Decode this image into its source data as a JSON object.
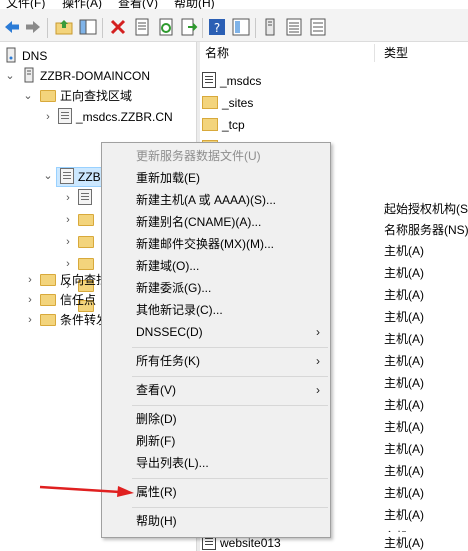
{
  "menubar": {
    "items": [
      "文件(F)",
      "操作(A)",
      "查看(V)",
      "帮助(H)"
    ]
  },
  "tree": {
    "root": "DNS",
    "server": "ZZBR-DOMAINCON",
    "forward_zones": "正向查找区域",
    "msdcs_zone": "_msdcs.ZZBR.CN",
    "zzbr_zone": "ZZBR.CN",
    "reverse_zones": "反向查找区域",
    "trust_points": "信任点",
    "conditional_forwarders": "条件转发器"
  },
  "list": {
    "col_name": "名称",
    "col_type": "类型",
    "rows": [
      {
        "name": "_msdcs",
        "type": ""
      },
      {
        "name": "_sites",
        "type": ""
      },
      {
        "name": "_tcp",
        "type": ""
      },
      {
        "name": "",
        "type": ""
      },
      {
        "name": "",
        "type": ""
      },
      {
        "name": "",
        "type": ""
      },
      {
        "name": "",
        "type": "起始授权机构(S"
      },
      {
        "name": "",
        "type": "名称服务器(NS)"
      },
      {
        "name": "",
        "type": "主机(A)"
      },
      {
        "name": "",
        "type": "主机(A)"
      },
      {
        "name": "",
        "type": "主机(A)"
      },
      {
        "name": "",
        "type": "主机(A)"
      },
      {
        "name": "",
        "type": "主机(A)"
      },
      {
        "name": "",
        "type": "主机(A)"
      },
      {
        "name": "",
        "type": "主机(A)"
      },
      {
        "name": "",
        "type": "主机(A)"
      },
      {
        "name": "",
        "type": "主机(A)"
      },
      {
        "name": "",
        "type": "主机(A)"
      },
      {
        "name": "",
        "type": "主机(A)"
      },
      {
        "name": "",
        "type": "主机(A)"
      },
      {
        "name": "",
        "type": "主机(A)"
      },
      {
        "name": "",
        "type": "主机(A)"
      },
      {
        "name": "",
        "type": "主机(A)"
      },
      {
        "name": "website013",
        "type": "主机(A)"
      }
    ]
  },
  "context_menu": {
    "update_server_data": "更新服务器数据文件(U)",
    "reload": "重新加载(E)",
    "new_host": "新建主机(A 或 AAAA)(S)...",
    "new_alias": "新建别名(CNAME)(A)...",
    "new_mx": "新建邮件交换器(MX)(M)...",
    "new_domain": "新建域(O)...",
    "new_delegation": "新建委派(G)...",
    "other_records": "其他新记录(C)...",
    "dnssec": "DNSSEC(D)",
    "all_tasks": "所有任务(K)",
    "view": "查看(V)",
    "delete": "删除(D)",
    "refresh": "刷新(F)",
    "export_list": "导出列表(L)...",
    "properties": "属性(R)",
    "help": "帮助(H)"
  },
  "colors": {
    "selection": "#cce8ff",
    "annotation_arrow": "#e02020"
  }
}
